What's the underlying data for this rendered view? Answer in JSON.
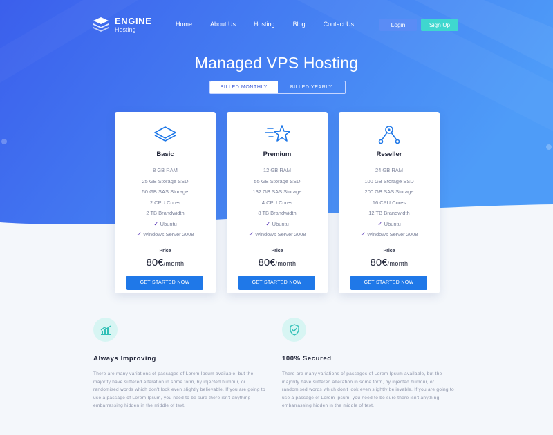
{
  "brand": {
    "name": "ENGINE",
    "sub": "Hosting"
  },
  "nav": [
    "Home",
    "About Us",
    "Hosting",
    "Blog",
    "Contact Us"
  ],
  "auth": {
    "login": "Login",
    "signup": "Sign Up"
  },
  "hero": {
    "title": "Managed VPS Hosting"
  },
  "billing": {
    "monthly": "BILLED MONTHLY",
    "yearly": "BILLED YEARLY",
    "selected": "monthly"
  },
  "plans": [
    {
      "name": "Basic",
      "icon": "layers-icon",
      "specs": [
        "8 GB RAM",
        "25 GB Storage SSD",
        "50 GB SAS Storage",
        "2 CPU Cores",
        "2 TB Brandwidth"
      ],
      "os": [
        "Ubuntu",
        "Windows Server 2008"
      ],
      "price_label": "Price",
      "price": "80€",
      "per": "/month",
      "cta": "GET STARTED NOW"
    },
    {
      "name": "Premium",
      "icon": "star-icon",
      "specs": [
        "12 GB RAM",
        "55 GB Storage SSD",
        "132 GB SAS Storage",
        "4 CPU Cores",
        "8 TB Brandwidth"
      ],
      "os": [
        "Ubuntu",
        "Windows Server 2008"
      ],
      "price_label": "Price",
      "price": "80€",
      "per": "/month",
      "cta": "GET STARTED NOW"
    },
    {
      "name": "Reseller",
      "icon": "network-icon",
      "specs": [
        "24 GB RAM",
        "100 GB Storage SSD",
        "200 GB SAS Storage",
        "16 CPU Cores",
        "12 TB Brandwidth"
      ],
      "os": [
        "Ubuntu",
        "Windows Server 2008"
      ],
      "price_label": "Price",
      "price": "80€",
      "per": "/month",
      "cta": "GET STARTED NOW"
    }
  ],
  "features": [
    {
      "icon": "chart-icon",
      "title": "Always Improving",
      "text": "There are many variations of passages of Lorem Ipsum available, but the majority have suffered alteration in some form, by injected humour, or randomised words which don't look even slightly believable. If you are going to use a passage of Lorem Ipsum, you need to be sure there isn't anything embarrassing hidden in the middle of text."
    },
    {
      "icon": "shield-check-icon",
      "title": "100% Secured",
      "text": "There are many variations of passages of Lorem Ipsum available, but the majority have suffered alteration in some form, by injected humour, or randomised words which don't look even slightly believable. If you are going to use a passage of Lorem Ipsum, you need to be sure there isn't anything embarrassing hidden in the middle of text."
    }
  ],
  "colors": {
    "hero_start": "#3a63ee",
    "hero_end": "#4d9bf7",
    "cta": "#1f78e8",
    "signup": "#3fd7cf",
    "check": "#5b3ab8",
    "feature_icon_bg": "#d7f5f3"
  }
}
